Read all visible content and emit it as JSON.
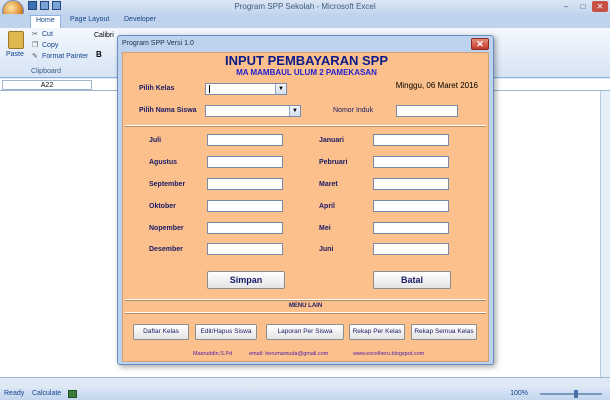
{
  "excel": {
    "window_title": "Program SPP Sekolah - Microsoft Excel",
    "tabs": [
      "Home",
      "Page Layout",
      "Developer"
    ],
    "clipboard": {
      "paste": "Paste",
      "cut": "Cut",
      "copy": "Copy",
      "format_painter": "Format Painter",
      "group": "Clipboard"
    },
    "font_name": "Calibri",
    "bold": "B",
    "name_box": "A22",
    "status": {
      "ready": "Ready",
      "calculate": "Calculate",
      "zoom": "100%"
    }
  },
  "form": {
    "window_title": "Program SPP Versi 1.0",
    "heading": "INPUT PEMBAYARAN SPP",
    "school": "MA MAMBAUL ULUM 2 PAMEKASAN",
    "date": "Minggu, 06 Maret 2016",
    "labels": {
      "kelas": "Pilih Kelas",
      "siswa": "Pilih Nama Siswa",
      "nomor_induk": "Nomor Induk"
    },
    "months_left": [
      "Juli",
      "Agustus",
      "September",
      "Oktober",
      "Nopember",
      "Desember"
    ],
    "months_right": [
      "Januari",
      "Pebruari",
      "Maret",
      "April",
      "Mei",
      "Juni"
    ],
    "buttons": {
      "save": "Simpan",
      "cancel": "Batal"
    },
    "menu_title": "MENU LAIN",
    "menu_buttons": [
      "Daftar Kelas",
      "Edit/Hapus Siswa",
      "Laporan Per Siswa",
      "Rekap Per Kelas",
      "Rekap Semua Kelas"
    ],
    "footer": {
      "author": "Masruddin,S.Pd",
      "email": "email: herumamuda@gmail.com",
      "site": "www.excelheru.blogspot.com"
    }
  }
}
